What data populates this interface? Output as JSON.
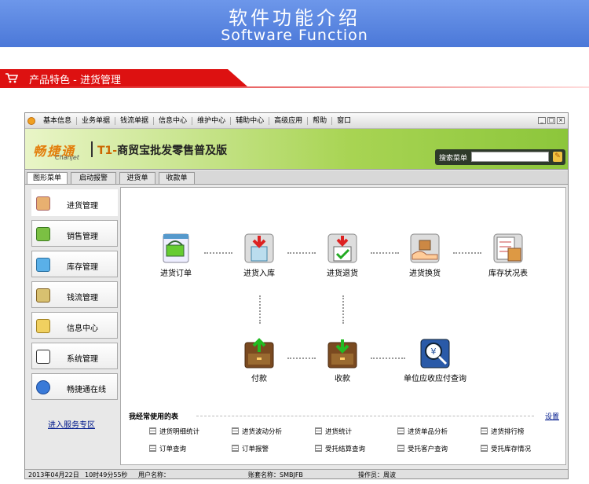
{
  "banner": {
    "title_cn": "软件功能介绍",
    "title_en": "Software Function"
  },
  "section": {
    "title": "产品特色 - 进货管理"
  },
  "window": {
    "menu": [
      "基本信息",
      "业务单据",
      "钱流单据",
      "信息中心",
      "维护中心",
      "辅助中心",
      "高级应用",
      "帮助",
      "窗口"
    ],
    "brand_name": "畅捷通",
    "brand_sub": "Chanjet",
    "product_code": "T1-",
    "product_name": "商贸宝批发零售普及版",
    "search_label": "搜索菜单",
    "tabs": [
      "图形菜单",
      "启动报警",
      "进货单",
      "收款单"
    ],
    "sidebar": [
      "进货管理",
      "销售管理",
      "库存管理",
      "钱流管理",
      "信息中心",
      "系统管理",
      "畅捷通在线"
    ],
    "service_link": "进入服务专区",
    "flow": [
      "进货订单",
      "进货入库",
      "进货退货",
      "进货换货",
      "库存状况表",
      "付款",
      "收款",
      "单位应收应付查询"
    ],
    "freq_title": "我经常使用的表",
    "freq_settings": "设置",
    "freq_items": [
      "进货明细统计",
      "进货波动分析",
      "进货统计",
      "进货单品分析",
      "进货排行榜",
      "订单查询",
      "订单报警",
      "受托结算查询",
      "受托客户查询",
      "受托库存情况"
    ],
    "status": {
      "date": "2013年04月22日",
      "time": "10时49分55秒",
      "user": "用户名称：",
      "account": "账套名称：SMBJFB",
      "operator": "操作员：周波"
    }
  },
  "colors": {
    "banner": "#5a86e0",
    "section_red": "#dd1111",
    "brand_green": "#a8d453",
    "link": "#001a8c"
  }
}
